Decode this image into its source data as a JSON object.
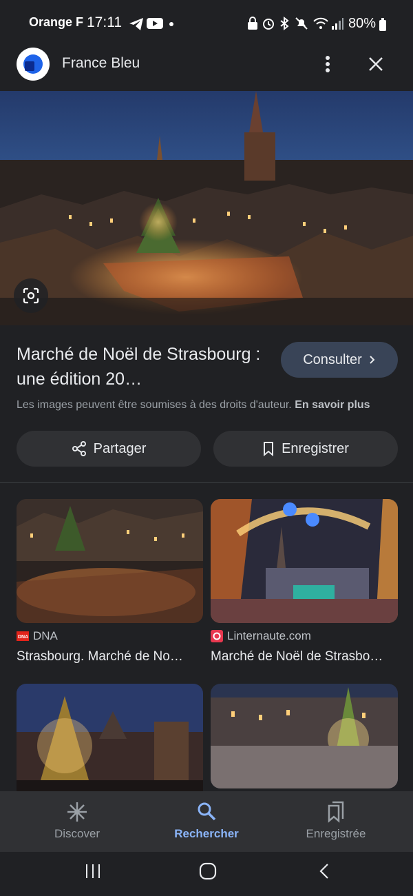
{
  "status_bar": {
    "carrier": "Orange F",
    "time": "17:11",
    "battery": "80%",
    "icons": [
      "telegram-icon",
      "youtube-icon",
      "dot-icon",
      "lock-icon",
      "alarm-icon",
      "bluetooth-icon",
      "mute-icon",
      "wifi-icon",
      "signal-icon",
      "battery-icon"
    ]
  },
  "header": {
    "site_name": "France Bleu",
    "icons": [
      "site-logo-icon",
      "more-vert-icon",
      "close-icon"
    ]
  },
  "main": {
    "title": "Marché de Noël de Strasbourg : une édition 20…",
    "consult_label": "Consulter",
    "copyright_text": "Les images peuvent être soumises à des droits d'auteur.",
    "learn_more": "En savoir plus",
    "share_label": "Partager",
    "save_label": "Enregistrer"
  },
  "results": [
    {
      "source": "DNA",
      "caption": "Strasbourg. Marché de No…",
      "icon": "dna-logo-icon"
    },
    {
      "source": "Linternaute.com",
      "caption": "Marché de Noël de Strasbo…",
      "icon": "linternaute-logo-icon"
    },
    {
      "source": "",
      "caption": "",
      "icon": ""
    },
    {
      "source": "",
      "caption": "",
      "icon": ""
    }
  ],
  "bottom_nav": {
    "items": [
      {
        "label": "Discover",
        "icon": "asterisk-icon",
        "active": false
      },
      {
        "label": "Rechercher",
        "icon": "search-icon",
        "active": true
      },
      {
        "label": "Enregistrée",
        "icon": "bookmarks-icon",
        "active": false
      }
    ]
  },
  "colors": {
    "background": "#202124",
    "accent": "#8ab4f8",
    "button_consult": "#394457",
    "pill": "#303134"
  }
}
